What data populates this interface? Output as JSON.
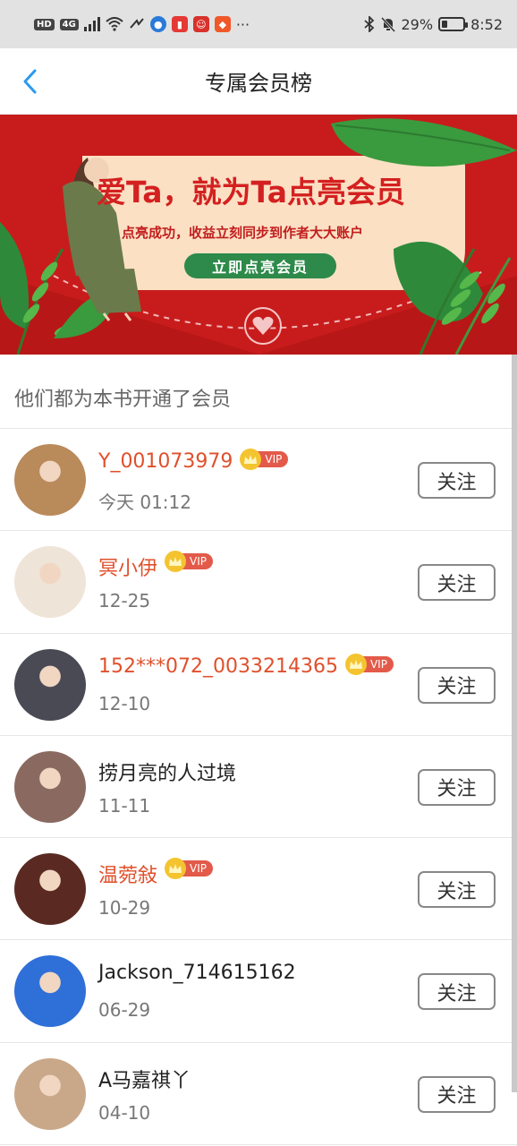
{
  "status_bar": {
    "left_chips": [
      "HD",
      "4G"
    ],
    "battery_percent": "29%",
    "battery_level": 0.29,
    "time": "8:52",
    "more": "···"
  },
  "nav": {
    "title": "专属会员榜"
  },
  "banner": {
    "headline": "爱Ta，就为Ta点亮会员",
    "subtitle": "点亮成功，收益立刻同步到作者大大账户",
    "cta": "立即点亮会员"
  },
  "section_title": "他们都为本书开通了会员",
  "vip_tag": "VIP",
  "follow_label": "关注",
  "members": [
    {
      "name": "Y_001073979",
      "date": "今天 01:12",
      "vip": true,
      "avatar_color": "#b98a5a"
    },
    {
      "name": "冥小伊",
      "date": "12-25",
      "vip": true,
      "avatar_color": "#efe4d8"
    },
    {
      "name": "152***072_0033214365",
      "date": "12-10",
      "vip": true,
      "avatar_color": "#4a4a55"
    },
    {
      "name": "捞月亮的人过境",
      "date": "11-11",
      "vip": false,
      "avatar_color": "#8a6a60"
    },
    {
      "name": "温菀敍",
      "date": "10-29",
      "vip": true,
      "avatar_color": "#5a2a22"
    },
    {
      "name": "Jackson_714615162",
      "date": "06-29",
      "vip": false,
      "avatar_color": "#2f6fd8"
    },
    {
      "name": "A马嘉祺丫",
      "date": "04-10",
      "vip": false,
      "avatar_color": "#c9a88a"
    }
  ]
}
